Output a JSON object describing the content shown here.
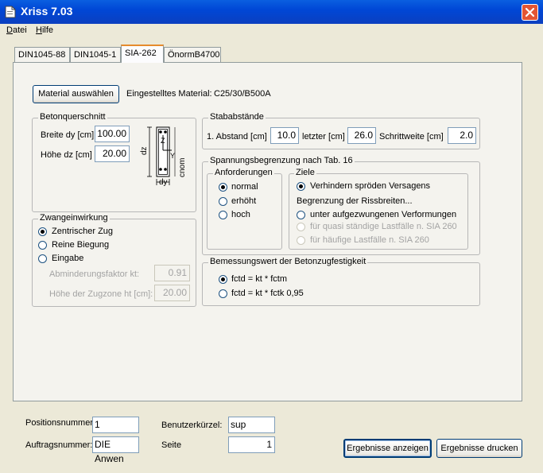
{
  "window": {
    "title": "Xriss 7.03"
  },
  "menu": {
    "items": [
      "Datei",
      "Hilfe"
    ]
  },
  "tabs": [
    {
      "label": "DIN1045-88"
    },
    {
      "label": "DIN1045-1"
    },
    {
      "label": "SIA-262"
    },
    {
      "label": "ÖnormB4700"
    }
  ],
  "material": {
    "button_label": "Material auswählen",
    "caption": "Eingestelltes Material:",
    "value": "C25/30/B500A"
  },
  "betonquerschnitt": {
    "title": "Betonquerschnitt",
    "breite_label": "Breite dy [cm]",
    "breite_value": "100.00",
    "hoehe_label": "Höhe dz [cm]",
    "hoehe_value": "20.00",
    "diagram": {
      "dz": "dz",
      "dy": "dy",
      "z": "Z",
      "y": "Y",
      "cnom": "cnom"
    }
  },
  "zwang": {
    "title": "Zwangeinwirkung",
    "options": [
      "Zentrischer Zug",
      "Reine Biegung",
      "Eingabe"
    ],
    "selected": 0,
    "abminderung_label": "Abminderungsfaktor kt:",
    "abminderung_value": "0.91",
    "hoehe_zugzone_label": "Höhe der Zugzone ht [cm]:",
    "hoehe_zugzone_value": "20.00"
  },
  "stababstaende": {
    "title": "Stababstände",
    "erster_label": "1. Abstand [cm]",
    "erster_value": "10.0",
    "letzter_label": "letzter [cm]",
    "letzter_value": "26.0",
    "schrittweite_label": "Schrittweite [cm]",
    "schrittweite_value": "2.0"
  },
  "spannung": {
    "title": "Spannungsbegrenzung nach Tab. 16",
    "anforderungen": {
      "title": "Anforderungen",
      "options": [
        "normal",
        "erhöht",
        "hoch"
      ],
      "selected": 0
    },
    "ziele": {
      "title": "Ziele",
      "option_sproed": "Verhindern spröden Versagens",
      "begrenzung_caption": "Begrenzung der Rissbreiten...",
      "option_aufgezwungen": "unter aufgezwungenen Verformungen",
      "option_quasi": "für quasi ständige Lastfälle n. SIA 260",
      "option_haeufig": "für häufige Lastfälle n. SIA 260"
    }
  },
  "bemessung": {
    "title": "Bemessungswert der Betonzugfestigkeit",
    "options": [
      "fctd = kt * fctm",
      "fctd = kt * fctk 0,95"
    ],
    "selected": 0
  },
  "footer": {
    "positionsnummer_label": "Positionsnummer:",
    "positionsnummer_value": "1",
    "auftragsnummer_label": "Auftragsnummer:",
    "auftragsnummer_value": "DIE Anwen",
    "benutzer_label": "Benutzerkürzel:",
    "benutzer_value": "sup",
    "seite_label": "Seite",
    "seite_value": "1",
    "anzeigen_label": "Ergebnisse anzeigen",
    "drucken_label": "Ergebnisse drucken"
  },
  "colors": {
    "titlebar": "#0a5fe0",
    "tab_highlight": "#e68b2c",
    "radio_selected": "#21a121",
    "close_button": "#e35534"
  }
}
